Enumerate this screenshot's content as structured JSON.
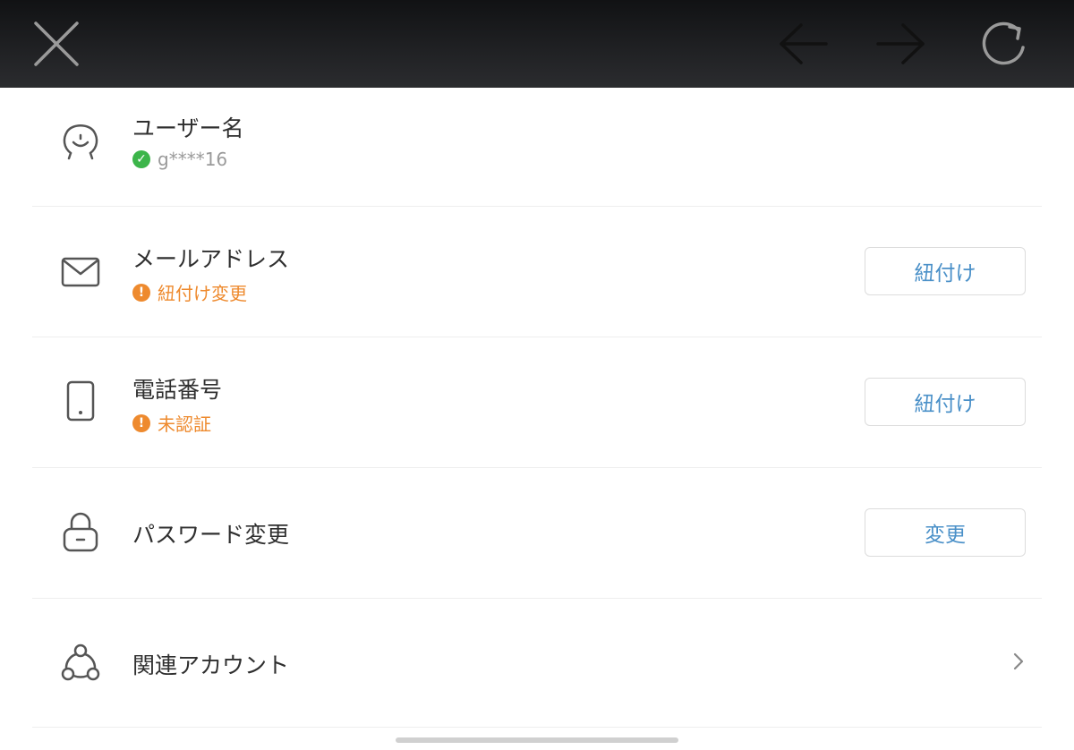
{
  "toolbar": {
    "close_icon": "close-icon",
    "back_icon": "arrow-left-icon",
    "forward_icon": "arrow-right-icon",
    "reload_icon": "reload-icon"
  },
  "rows": {
    "username": {
      "title": "ユーザー名",
      "status": "g****16",
      "status_icon": "check-circle-icon",
      "icon": "user-face-icon"
    },
    "email": {
      "title": "メールアドレス",
      "status": "紐付け変更",
      "status_icon": "exclamation-circle-icon",
      "action": "紐付け",
      "icon": "mail-icon"
    },
    "phone": {
      "title": "電話番号",
      "status": "未認証",
      "status_icon": "exclamation-circle-icon",
      "action": "紐付け",
      "icon": "phone-icon"
    },
    "password": {
      "title": "パスワード変更",
      "action": "変更",
      "icon": "lock-icon"
    },
    "linked": {
      "title": "関連アカウント",
      "icon": "linked-accounts-icon"
    }
  },
  "colors": {
    "accent": "#4a90c8",
    "ok": "#3cb54a",
    "warn": "#ee8a2e",
    "toolbar_bg": "#1c1d20"
  }
}
